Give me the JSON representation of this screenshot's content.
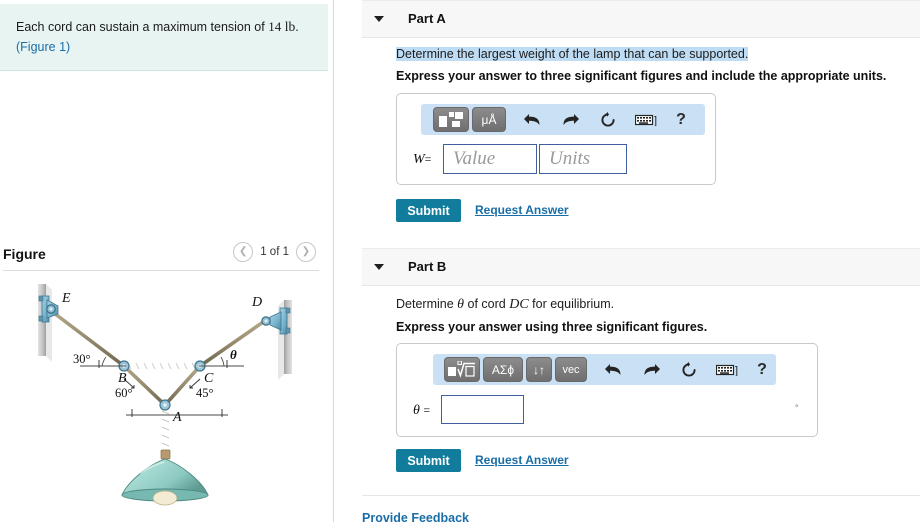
{
  "problem": {
    "statement_pre": "Each cord can sustain a maximum tension of",
    "statement_value": "14",
    "statement_unit": "lb",
    "statement_post": ".",
    "figure_link": "(Figure 1)"
  },
  "figure_panel": {
    "title": "Figure",
    "prev_icon": "chevron-left-icon",
    "next_icon": "chevron-right-icon",
    "counter": "1 of 1",
    "diagram": {
      "labels": {
        "E": "E",
        "D": "D",
        "B": "B",
        "C": "C",
        "A": "A",
        "theta": "θ",
        "angle_EB": "30°",
        "angle_BA": "60°",
        "angle_CA": "45°"
      },
      "colors": {
        "cord": "#9b8f72",
        "bracket": "#6ba8c4",
        "lamp": "#8fc9c1",
        "wall": "#b9b9b9"
      }
    }
  },
  "parts": [
    {
      "id": "part-a",
      "caret_icon": "caret-down-icon",
      "label": "Part A",
      "question": "Determine the largest weight of the lamp that can be supported.",
      "instruction": "Express your answer to three significant figures and include the appropriate units.",
      "variable": "W",
      "equals": "=",
      "value_placeholder": "Value",
      "units_placeholder": "Units",
      "value_current": "",
      "units_current": "",
      "toolbar": [
        {
          "name": "template-fraction-button",
          "glyph": "template-a"
        },
        {
          "name": "units-button",
          "glyph": "μÅ"
        },
        {
          "name": "undo-button",
          "glyph": "↶"
        },
        {
          "name": "redo-button",
          "glyph": "↷"
        },
        {
          "name": "reset-button",
          "glyph": "↻"
        },
        {
          "name": "keyboard-shortcuts-button",
          "glyph": "⌨]"
        },
        {
          "name": "help-button",
          "glyph": "?"
        }
      ],
      "submit_label": "Submit",
      "request_answer_label": "Request Answer"
    },
    {
      "id": "part-b",
      "caret_icon": "caret-down-icon",
      "label": "Part B",
      "question_pre": "Determine",
      "question_var": "θ",
      "question_mid": "of cord",
      "question_cord": "DC",
      "question_post": "for equilibrium.",
      "instruction": "Express your answer using three significant figures.",
      "variable": "θ",
      "equals": "=",
      "value_current": "",
      "unit_suffix": "°",
      "toolbar": [
        {
          "name": "template-radical-button",
          "glyph": "template-b"
        },
        {
          "name": "greek-letters-button",
          "glyph": "ΑΣϕ"
        },
        {
          "name": "arrows-button",
          "glyph": "↓↑"
        },
        {
          "name": "vector-button",
          "glyph": "vec"
        },
        {
          "name": "undo-button",
          "glyph": "↶"
        },
        {
          "name": "redo-button",
          "glyph": "↷"
        },
        {
          "name": "reset-button",
          "glyph": "↻"
        },
        {
          "name": "keyboard-shortcuts-button",
          "glyph": "⌨]"
        },
        {
          "name": "help-button",
          "glyph": "?"
        }
      ],
      "submit_label": "Submit",
      "request_answer_label": "Request Answer"
    }
  ],
  "footer": {
    "feedback_label": "Provide Feedback"
  },
  "colors": {
    "accent": "#127c9c",
    "link": "#1a6ea8",
    "highlight": "#bfdcf5",
    "problem_bg": "#e8f4f2",
    "toolbar_bg": "#c9e0f5"
  }
}
